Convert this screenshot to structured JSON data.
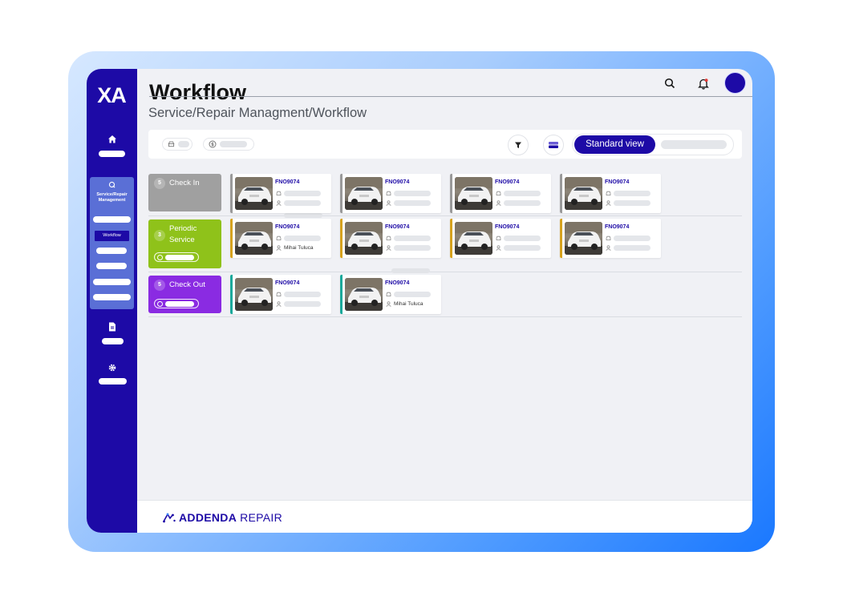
{
  "app": {
    "logo": "XA",
    "title": "Workflow",
    "breadcrumb": "Service/Repair Managment/Workflow"
  },
  "sidebar": {
    "group_label": "Service/Repair Management",
    "active_item": "Workflow"
  },
  "toolbar": {
    "view_active": "Standard view"
  },
  "stages": [
    {
      "name": "Check In",
      "count": "5",
      "color": "#a0a0a0"
    },
    {
      "name": "Periodic Service",
      "count": "3",
      "color": "#8fc21a"
    },
    {
      "name": "Check Out",
      "count": "5",
      "color": "#8a2be2"
    }
  ],
  "cards": {
    "id": "FNO9074",
    "assignee": "Mihai Tuluca",
    "accent_checkin": "#9a9a9a",
    "accent_periodic": "#d6a21e",
    "accent_checkout": "#1aa99b"
  },
  "footer": {
    "brand_bold": "ADDENDA",
    "brand_light": "REPAIR"
  },
  "colors": {
    "primary": "#1d0aa6",
    "frame": "#4f9bff"
  }
}
